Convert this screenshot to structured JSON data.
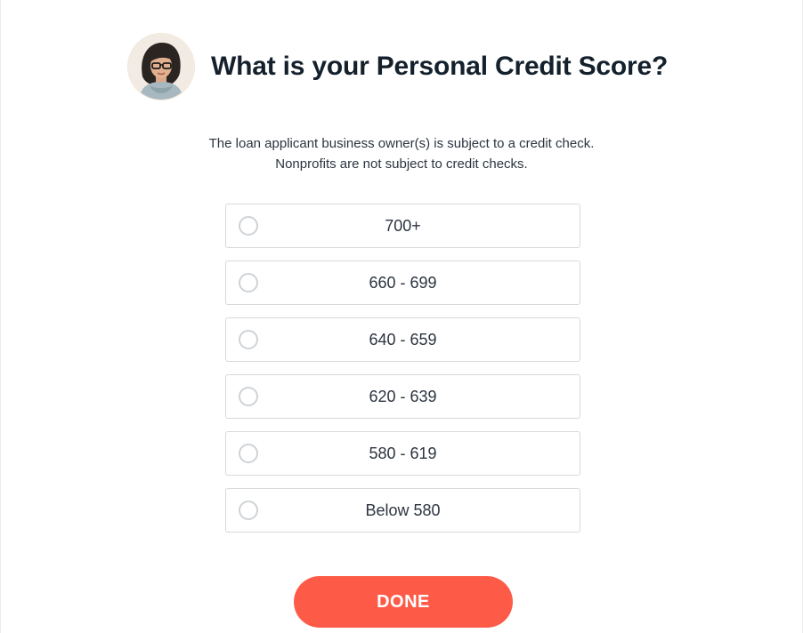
{
  "header": {
    "avatar_icon": "advisor-avatar",
    "title": "What is your Personal Credit Score?"
  },
  "subtitle": {
    "line1": "The loan applicant business owner(s) is subject to a credit check.",
    "line2": "Nonprofits are not subject to credit checks."
  },
  "options": [
    {
      "label": "700+",
      "selected": false
    },
    {
      "label": "660 - 699",
      "selected": false
    },
    {
      "label": "640 - 659",
      "selected": false
    },
    {
      "label": "620 - 639",
      "selected": false
    },
    {
      "label": "580 - 619",
      "selected": false
    },
    {
      "label": "Below 580",
      "selected": false
    }
  ],
  "done_button": {
    "label": "DONE",
    "color": "#fd5b48"
  }
}
